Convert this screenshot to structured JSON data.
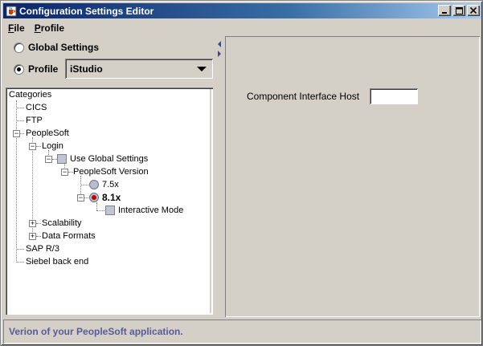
{
  "window": {
    "title": "Configuration Settings Editor",
    "icon": "java-coffee-cup-icon"
  },
  "menu": {
    "items": [
      {
        "label": "File",
        "mnemonic": "F",
        "rest": "ile"
      },
      {
        "label": "Profile",
        "mnemonic": "P",
        "rest": "rofile"
      }
    ]
  },
  "settings_mode": {
    "global_label": "Global Settings",
    "global_selected": false,
    "profile_label": "Profile",
    "profile_selected": true,
    "profile_value": "iStudio"
  },
  "tree": {
    "root": "Categories",
    "nodes": {
      "cics": "CICS",
      "ftp": "FTP",
      "peoplesoft": "PeopleSoft",
      "login": "Login",
      "use_global": "Use Global Settings",
      "ps_version": "PeopleSoft Version",
      "v75": "7.5x",
      "v81": "8.1x",
      "interactive": "Interactive Mode",
      "scalability": "Scalability",
      "data_formats": "Data Formats",
      "sap": "SAP R/3",
      "siebel": "Siebel back end"
    },
    "selected_version": "8.1x"
  },
  "detail": {
    "component_interface_host_label": "Component Interface Host",
    "component_interface_host_value": ""
  },
  "status": {
    "text": "Verion of your PeopleSoft application."
  },
  "colors": {
    "title_bar": "#0a246a",
    "status_text": "#5a5a96",
    "radio_selected": "#c00000"
  }
}
